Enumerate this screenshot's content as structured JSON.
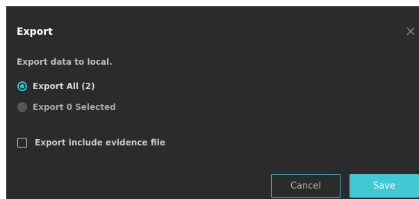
{
  "dialog": {
    "title": "Export",
    "description": "Export data to local.",
    "options": [
      {
        "label": "Export All (2)",
        "checked": true
      },
      {
        "label": "Export 0 Selected",
        "checked": false,
        "disabled": true
      }
    ],
    "include_evidence_label": "Export include evidence file",
    "include_evidence_checked": false,
    "cancel_label": "Cancel",
    "save_label": "Save",
    "close_icon": "close-icon"
  },
  "colors": {
    "dialog_bg": "#2b2b2b",
    "accent": "#36c2cf",
    "save_bg": "#41c8d3"
  }
}
